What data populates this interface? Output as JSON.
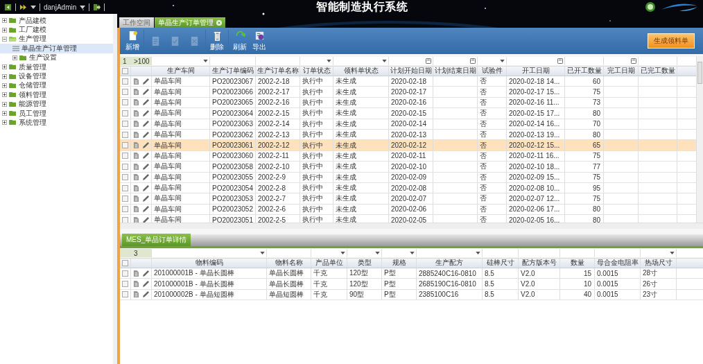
{
  "top_bar": {
    "user": "danjAdmin"
  },
  "app_title": "智能制造执行系统",
  "sidebar": {
    "items": [
      {
        "label": "产品建模",
        "expanded": false,
        "selected": false
      },
      {
        "label": "工厂建模",
        "expanded": false,
        "selected": false
      },
      {
        "label": "生产管理",
        "expanded": true,
        "selected": false,
        "children": [
          {
            "label": "单晶生产订单管理",
            "kind": "leaf",
            "selected": true
          },
          {
            "label": "生产设置",
            "kind": "folder",
            "expanded": false,
            "selected": false
          }
        ]
      },
      {
        "label": "质量管理",
        "expanded": false,
        "selected": false
      },
      {
        "label": "设备管理",
        "expanded": false,
        "selected": false
      },
      {
        "label": "仓储管理",
        "expanded": false,
        "selected": false
      },
      {
        "label": "领料管理",
        "expanded": false,
        "selected": false
      },
      {
        "label": "能源管理",
        "expanded": false,
        "selected": false
      },
      {
        "label": "员工管理",
        "expanded": false,
        "selected": false
      },
      {
        "label": "系统管理",
        "expanded": false,
        "selected": false
      }
    ]
  },
  "tabs": [
    {
      "label": "工作空间",
      "selected": false
    },
    {
      "label": "单晶生产订单管理",
      "selected": true
    }
  ],
  "toolbar": {
    "buttons": [
      {
        "kind": "new",
        "label": "新增",
        "disabled": false
      },
      {
        "kind": "edit",
        "disabled": true
      },
      {
        "kind": "audit",
        "disabled": true
      },
      {
        "kind": "revoke",
        "disabled": true
      },
      {
        "kind": "delete",
        "label": "删除",
        "disabled": false
      },
      {
        "kind": "refresh",
        "label": "刷新",
        "disabled": false
      },
      {
        "kind": "export",
        "label": "导出",
        "disabled": false
      }
    ],
    "action_button": "生成领料单"
  },
  "orders": {
    "row_marker": "1",
    "count_filter": ">100",
    "all_checked": false,
    "columns": [
      {
        "label": "生产车间",
        "kind": "dropdown"
      },
      {
        "label": "生产订单编码",
        "kind": "plain"
      },
      {
        "label": "生产订单名称",
        "kind": "plain"
      },
      {
        "label": "订单状态",
        "kind": "dropdown"
      },
      {
        "label": "领料单状态",
        "kind": "dropdown"
      },
      {
        "label": "计划开始日期",
        "kind": "date"
      },
      {
        "label": "计划结束日期",
        "kind": "date"
      },
      {
        "label": "试验件",
        "kind": "dropdown"
      },
      {
        "label": "开工日期",
        "kind": "date"
      },
      {
        "label": "已开工数量",
        "kind": "plain"
      },
      {
        "label": "完工日期",
        "kind": "date"
      },
      {
        "label": "已完工数量",
        "kind": "plain"
      }
    ],
    "rows": [
      {
        "selected": false,
        "checked": false,
        "cells": [
          "单晶车间",
          "PO20023067",
          "2002-2-18",
          "执行中",
          "未生成",
          "2020-02-18",
          "",
          "否",
          "2020-02-18 14...",
          "60",
          "",
          ""
        ]
      },
      {
        "selected": false,
        "checked": false,
        "cells": [
          "单晶车间",
          "PO20023066",
          "2002-2-17",
          "执行中",
          "未生成",
          "2020-02-17",
          "",
          "否",
          "2020-02-17 15...",
          "75",
          "",
          ""
        ]
      },
      {
        "selected": false,
        "checked": false,
        "cells": [
          "单晶车间",
          "PO20023065",
          "2002-2-16",
          "执行中",
          "未生成",
          "2020-02-16",
          "",
          "否",
          "2020-02-16 11...",
          "73",
          "",
          ""
        ]
      },
      {
        "selected": false,
        "checked": false,
        "cells": [
          "单晶车间",
          "PO20023064",
          "2002-2-15",
          "执行中",
          "未生成",
          "2020-02-15",
          "",
          "否",
          "2020-02-15 17...",
          "80",
          "",
          ""
        ]
      },
      {
        "selected": false,
        "checked": false,
        "cells": [
          "单晶车间",
          "PO20023063",
          "2002-2-14",
          "执行中",
          "未生成",
          "2020-02-14",
          "",
          "否",
          "2020-02-14 16...",
          "70",
          "",
          ""
        ]
      },
      {
        "selected": false,
        "checked": false,
        "cells": [
          "单晶车间",
          "PO20023062",
          "2002-2-13",
          "执行中",
          "未生成",
          "2020-02-13",
          "",
          "否",
          "2020-02-13 19...",
          "80",
          "",
          ""
        ]
      },
      {
        "selected": true,
        "checked": false,
        "cells": [
          "单晶车间",
          "PO20023061",
          "2002-2-12",
          "执行中",
          "未生成",
          "2020-02-12",
          "",
          "否",
          "2020-02-12 15...",
          "65",
          "",
          ""
        ]
      },
      {
        "selected": false,
        "checked": false,
        "cells": [
          "单晶车间",
          "PO20023060",
          "2002-2-11",
          "执行中",
          "未生成",
          "2020-02-11",
          "",
          "否",
          "2020-02-11 16...",
          "75",
          "",
          ""
        ]
      },
      {
        "selected": false,
        "checked": false,
        "cells": [
          "单晶车间",
          "PO20023058",
          "2002-2-10",
          "执行中",
          "未生成",
          "2020-02-10",
          "",
          "否",
          "2020-02-10 18...",
          "77",
          "",
          ""
        ]
      },
      {
        "selected": false,
        "checked": false,
        "cells": [
          "单晶车间",
          "PO20023055",
          "2002-2-9",
          "执行中",
          "未生成",
          "2020-02-09",
          "",
          "否",
          "2020-02-09 15...",
          "75",
          "",
          ""
        ]
      },
      {
        "selected": false,
        "checked": false,
        "cells": [
          "单晶车间",
          "PO20023054",
          "2002-2-8",
          "执行中",
          "未生成",
          "2020-02-08",
          "",
          "否",
          "2020-02-08 10...",
          "95",
          "",
          ""
        ]
      },
      {
        "selected": false,
        "checked": false,
        "cells": [
          "单晶车间",
          "PO20023053",
          "2002-2-7",
          "执行中",
          "未生成",
          "2020-02-07",
          "",
          "否",
          "2020-02-07 12...",
          "75",
          "",
          ""
        ]
      },
      {
        "selected": false,
        "checked": false,
        "cells": [
          "单晶车间",
          "PO20023052",
          "2002-2-6",
          "执行中",
          "未生成",
          "2020-02-06",
          "",
          "否",
          "2020-02-06 17...",
          "80",
          "",
          ""
        ]
      },
      {
        "selected": false,
        "checked": false,
        "cells": [
          "单晶车间",
          "PO20023051",
          "2002-2-5",
          "执行中",
          "未生成",
          "2020-02-05",
          "",
          "否",
          "2020-02-05 16...",
          "80",
          "",
          ""
        ]
      }
    ]
  },
  "detail": {
    "tab": "MES_单品订单详情",
    "row_marker": "3",
    "all_checked": false,
    "columns": [
      {
        "label": "物料编码",
        "kind": "dropdown"
      },
      {
        "label": "物料名称",
        "kind": "plain"
      },
      {
        "label": "产品单位",
        "kind": "dropdown"
      },
      {
        "label": "类型",
        "kind": "dropdown"
      },
      {
        "label": "规格",
        "kind": "dropdown"
      },
      {
        "label": "生产配方",
        "kind": "dropdown"
      },
      {
        "label": "硅棒尺寸",
        "kind": "plain"
      },
      {
        "label": "配方版本号",
        "kind": "plain"
      },
      {
        "label": "数量",
        "kind": "plain"
      },
      {
        "label": "母合金电阻率",
        "kind": "plain"
      },
      {
        "label": "热场尺寸",
        "kind": "dropdown"
      }
    ],
    "rows": [
      {
        "selected": false,
        "checked": false,
        "cells": [
          "201000001B - 单晶长圆棒",
          "单晶长圆棒",
          "千克",
          "120型",
          "P型",
          "2885240C16-0810",
          "8.5",
          "V2.0",
          "15",
          "0.0015",
          "28寸"
        ]
      },
      {
        "selected": false,
        "checked": false,
        "cells": [
          "201000001B - 单晶长圆棒",
          "单晶长圆棒",
          "千克",
          "120型",
          "P型",
          "2685190C16-0810",
          "8.5",
          "V2.0",
          "10",
          "0.0015",
          "26寸"
        ]
      },
      {
        "selected": false,
        "checked": false,
        "cells": [
          "201000002B - 单晶短圆棒",
          "单晶短圆棒",
          "千克",
          "90型",
          "P型",
          "2385100C16",
          "8.5",
          "V2.0",
          "40",
          "0.0015",
          "23寸"
        ]
      }
    ]
  }
}
